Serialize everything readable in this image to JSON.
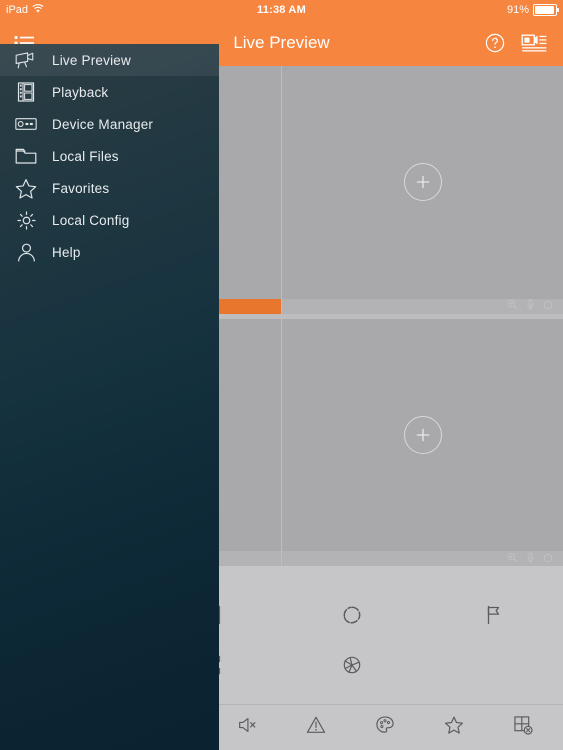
{
  "status_bar": {
    "device": "iPad",
    "wifi_icon": "wifi-icon",
    "time": "11:38 AM",
    "battery_percent": "91%",
    "battery_icon": "battery-icon"
  },
  "nav_bar": {
    "menu_icon": "list-menu-icon",
    "title": "Live Preview",
    "help_icon": "question-circle-icon",
    "device_list_icon": "device-list-icon",
    "background_color": "#f5853f",
    "text_color": "#ffffff"
  },
  "sidebar": {
    "background_gradient_from": "#2c3d44",
    "background_gradient_to": "#0b2230",
    "active_index": 0,
    "items": [
      {
        "label": "Live Preview",
        "icon": "camera-icon",
        "active": true
      },
      {
        "label": "Playback",
        "icon": "film-icon",
        "active": false
      },
      {
        "label": "Device Manager",
        "icon": "dvr-icon",
        "active": false
      },
      {
        "label": "Local Files",
        "icon": "folder-icon",
        "active": false
      },
      {
        "label": "Favorites",
        "icon": "star-icon",
        "active": false
      },
      {
        "label": "Local Config",
        "icon": "gear-icon",
        "active": false
      },
      {
        "label": "Help",
        "icon": "person-icon",
        "active": false
      }
    ]
  },
  "video_grid": {
    "placeholder_icon": "plus-circle-icon",
    "cell_background": "#a9a9ab",
    "active_bar_color": "#e8762c",
    "rows": [
      {
        "cells": [
          {
            "selected": true,
            "toolbar": [
              "zoom-in-icon",
              "microphone-icon",
              "record-circle-icon"
            ]
          },
          {
            "selected": false,
            "toolbar": [
              "zoom-in-icon",
              "microphone-icon",
              "record-circle-icon"
            ]
          }
        ]
      },
      {
        "cells": [
          {
            "selected": false,
            "toolbar": [
              "zoom-in-icon",
              "microphone-icon",
              "record-circle-icon"
            ]
          },
          {
            "selected": false,
            "toolbar": [
              "zoom-in-icon",
              "microphone-icon",
              "record-circle-icon"
            ]
          }
        ]
      }
    ]
  },
  "ptz_panel": {
    "controls": [
      {
        "name": "zoom-in",
        "icon": "magnifier-plus-icon"
      },
      {
        "name": "focus-near",
        "icon": "square-plus-icon"
      },
      {
        "name": "iris-open",
        "icon": "iris-open-icon"
      },
      {
        "name": "preset",
        "icon": "flag-icon"
      },
      {
        "name": "zoom-out",
        "icon": "magnifier-minus-icon"
      },
      {
        "name": "focus-far",
        "icon": "square-minus-icon"
      },
      {
        "name": "iris-close",
        "icon": "iris-close-icon"
      },
      {
        "name": "blank",
        "icon": ""
      }
    ]
  },
  "tab_bar": {
    "items": [
      {
        "name": "ptz",
        "icon": "ptz-dome-icon"
      },
      {
        "name": "stream",
        "icon": "monitor-wave-icon"
      },
      {
        "name": "talk",
        "icon": "microphone-icon"
      },
      {
        "name": "audio-off",
        "icon": "speaker-mute-icon"
      },
      {
        "name": "alarm",
        "icon": "warning-triangle-icon"
      },
      {
        "name": "image-color",
        "icon": "palette-icon"
      },
      {
        "name": "favorites",
        "icon": "star-icon"
      },
      {
        "name": "close-all",
        "icon": "grid-close-icon"
      }
    ]
  }
}
